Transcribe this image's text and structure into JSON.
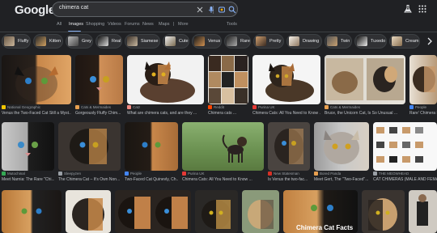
{
  "header": {
    "logo": "Google",
    "search_value": "chimera cat"
  },
  "tabs": [
    {
      "label": "All",
      "active": false
    },
    {
      "label": "Images",
      "active": true
    },
    {
      "label": "Shopping",
      "active": false
    },
    {
      "label": "Videos",
      "active": false
    },
    {
      "label": "Forums",
      "active": false
    },
    {
      "label": "News",
      "active": false
    },
    {
      "label": "Maps",
      "active": false
    },
    {
      "label": "More",
      "active": false
    },
    {
      "label": "Tools",
      "active": false
    }
  ],
  "chips": [
    "Fluffy",
    "Kitten",
    "Grey",
    "Real",
    "Siamese",
    "Cute",
    "Venus",
    "Rare",
    "Pretty",
    "Drawing",
    "Twin",
    "Tuxedo",
    "Cream"
  ],
  "results_row1": [
    {
      "source": "National Geographic",
      "title": "Venus the Two-Faced Cat Still a Myst..."
    },
    {
      "source": "Cats & Mermaides",
      "title": "Gorgeously Fluffy Chim..."
    },
    {
      "source": "Catz",
      "title": "What are chimera cats, and are they ..."
    },
    {
      "source": "Reddit",
      "title": "Chimera cats ..."
    },
    {
      "source": "Purina UK",
      "title": "Chimera Cats: All You Need to Know ..."
    },
    {
      "source": "Cats & Mermaides",
      "title": "Bruce, the Unicorn Cat, Is So Unusual ..."
    },
    {
      "source": "People",
      "title": "Rare' Chimera Ki..."
    }
  ],
  "results_row2": [
    {
      "source": "Mutochinal",
      "title": "Meet Narnia: The Rare \"Chi..."
    },
    {
      "source": "Sleepyzen",
      "title": "The Chimera Cat – It's Own Non..."
    },
    {
      "source": "People",
      "title": "Two-Faced Cat Quinevly, Ch..."
    },
    {
      "source": "Purina UK",
      "title": "Chimera Cats: All You Need to Know ..."
    },
    {
      "source": "New Statesman",
      "title": "Is Venus the two-fac..."
    },
    {
      "source": "Bored Panda",
      "title": "Meet Gert, The \"Two-Faced\"..."
    },
    {
      "source": "THE MEOWHEAD",
      "title": "CAT CHIMERAS (MALE AND FEMALE..."
    }
  ],
  "overlay_text": "Chimera Cat Facts",
  "colors": {
    "background": "#202124",
    "accent": "#8ab4f8",
    "text": "#e8eaed",
    "muted": "#9aa0a6"
  }
}
